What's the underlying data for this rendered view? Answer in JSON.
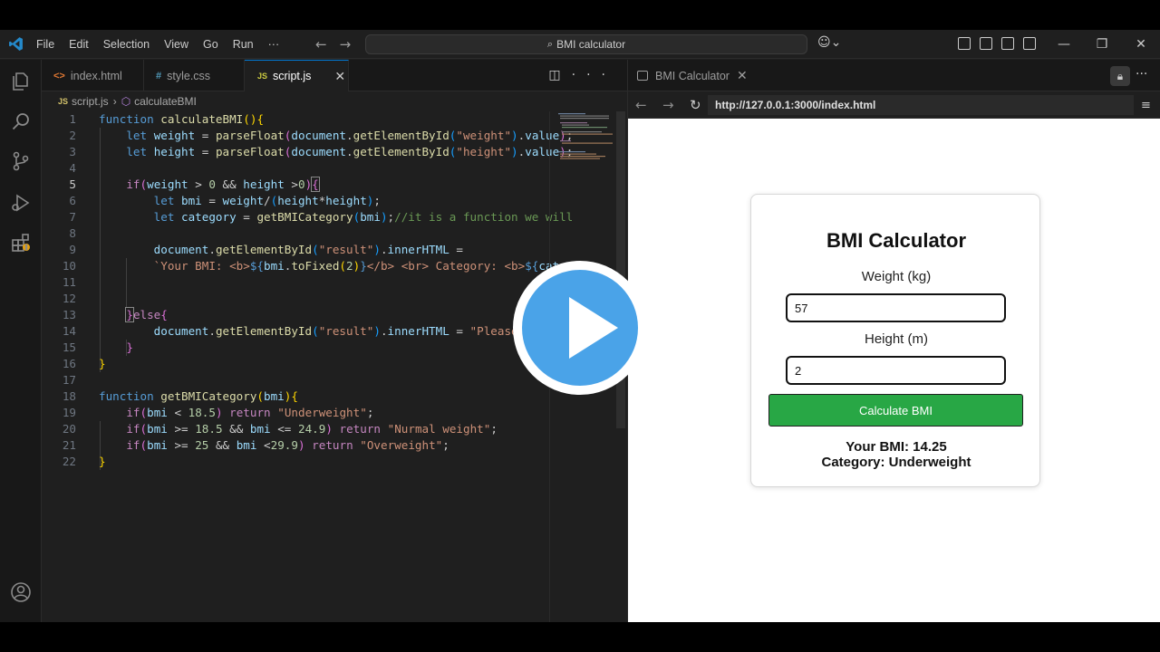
{
  "titlebar": {
    "menu": [
      "File",
      "Edit",
      "Selection",
      "View",
      "Go",
      "Run",
      "···"
    ],
    "search_text": "BMI calculator",
    "copilot": "copilot-icon",
    "window_controls": [
      "minimize-icon",
      "restore-icon",
      "close-icon"
    ]
  },
  "activity_bar": {
    "icons": [
      "explorer-icon",
      "search-icon",
      "source-control-icon",
      "run-debug-icon",
      "extensions-icon",
      "account-icon",
      "settings-gear-icon"
    ]
  },
  "editor": {
    "tabs": [
      {
        "label": "index.html",
        "icon": "<>",
        "icon_color": "#e37933"
      },
      {
        "label": "style.css",
        "icon": "#",
        "icon_color": "#519aba"
      },
      {
        "label": "script.js",
        "icon": "JS",
        "icon_color": "#cbcb41",
        "active": true
      }
    ],
    "breadcrumb": {
      "file": "script.js",
      "symbol": "calculateBMI"
    },
    "line_numbers": [
      "1",
      "2",
      "3",
      "4",
      "5",
      "6",
      "7",
      "8",
      "9",
      "10",
      "11",
      "12",
      "13",
      "14",
      "15",
      "16",
      "17",
      "18",
      "19",
      "20",
      "21",
      "22"
    ],
    "current_line": 5
  },
  "preview": {
    "tab_label": "BMI Calculator",
    "url": "http://127.0.0.1:3000/index.html",
    "card": {
      "title": "BMI Calculator",
      "weight_label": "Weight (kg)",
      "weight_value": "57",
      "height_label": "Height (m)",
      "height_value": "2",
      "button_label": "Calculate BMI",
      "result_bmi": "Your BMI: 14.25",
      "result_category": "Category: Underweight"
    }
  },
  "colors": {
    "accent": "#0078d4",
    "button_green": "#28a745",
    "play_blue": "#4aa3e8"
  }
}
